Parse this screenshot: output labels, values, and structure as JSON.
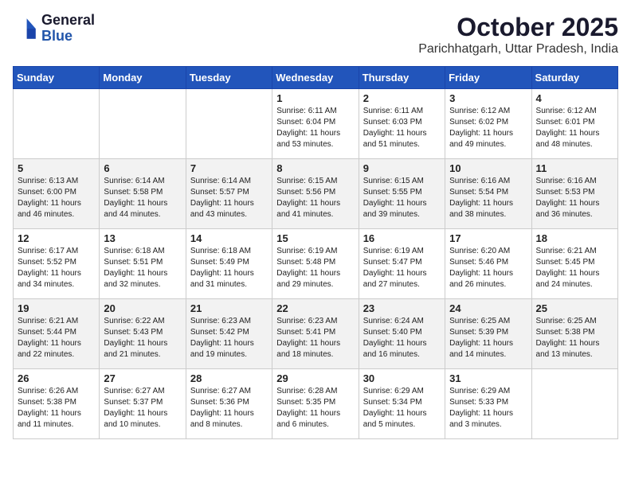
{
  "logo": {
    "line1": "General",
    "line2": "Blue"
  },
  "title": "October 2025",
  "location": "Parichhatgarh, Uttar Pradesh, India",
  "days_of_week": [
    "Sunday",
    "Monday",
    "Tuesday",
    "Wednesday",
    "Thursday",
    "Friday",
    "Saturday"
  ],
  "weeks": [
    [
      {
        "day": "",
        "text": "",
        "shaded": false
      },
      {
        "day": "",
        "text": "",
        "shaded": false
      },
      {
        "day": "",
        "text": "",
        "shaded": false
      },
      {
        "day": "1",
        "text": "Sunrise: 6:11 AM\nSunset: 6:04 PM\nDaylight: 11 hours and 53 minutes.",
        "shaded": false
      },
      {
        "day": "2",
        "text": "Sunrise: 6:11 AM\nSunset: 6:03 PM\nDaylight: 11 hours and 51 minutes.",
        "shaded": false
      },
      {
        "day": "3",
        "text": "Sunrise: 6:12 AM\nSunset: 6:02 PM\nDaylight: 11 hours and 49 minutes.",
        "shaded": false
      },
      {
        "day": "4",
        "text": "Sunrise: 6:12 AM\nSunset: 6:01 PM\nDaylight: 11 hours and 48 minutes.",
        "shaded": false
      }
    ],
    [
      {
        "day": "5",
        "text": "Sunrise: 6:13 AM\nSunset: 6:00 PM\nDaylight: 11 hours and 46 minutes.",
        "shaded": true
      },
      {
        "day": "6",
        "text": "Sunrise: 6:14 AM\nSunset: 5:58 PM\nDaylight: 11 hours and 44 minutes.",
        "shaded": true
      },
      {
        "day": "7",
        "text": "Sunrise: 6:14 AM\nSunset: 5:57 PM\nDaylight: 11 hours and 43 minutes.",
        "shaded": true
      },
      {
        "day": "8",
        "text": "Sunrise: 6:15 AM\nSunset: 5:56 PM\nDaylight: 11 hours and 41 minutes.",
        "shaded": true
      },
      {
        "day": "9",
        "text": "Sunrise: 6:15 AM\nSunset: 5:55 PM\nDaylight: 11 hours and 39 minutes.",
        "shaded": true
      },
      {
        "day": "10",
        "text": "Sunrise: 6:16 AM\nSunset: 5:54 PM\nDaylight: 11 hours and 38 minutes.",
        "shaded": true
      },
      {
        "day": "11",
        "text": "Sunrise: 6:16 AM\nSunset: 5:53 PM\nDaylight: 11 hours and 36 minutes.",
        "shaded": true
      }
    ],
    [
      {
        "day": "12",
        "text": "Sunrise: 6:17 AM\nSunset: 5:52 PM\nDaylight: 11 hours and 34 minutes.",
        "shaded": false
      },
      {
        "day": "13",
        "text": "Sunrise: 6:18 AM\nSunset: 5:51 PM\nDaylight: 11 hours and 32 minutes.",
        "shaded": false
      },
      {
        "day": "14",
        "text": "Sunrise: 6:18 AM\nSunset: 5:49 PM\nDaylight: 11 hours and 31 minutes.",
        "shaded": false
      },
      {
        "day": "15",
        "text": "Sunrise: 6:19 AM\nSunset: 5:48 PM\nDaylight: 11 hours and 29 minutes.",
        "shaded": false
      },
      {
        "day": "16",
        "text": "Sunrise: 6:19 AM\nSunset: 5:47 PM\nDaylight: 11 hours and 27 minutes.",
        "shaded": false
      },
      {
        "day": "17",
        "text": "Sunrise: 6:20 AM\nSunset: 5:46 PM\nDaylight: 11 hours and 26 minutes.",
        "shaded": false
      },
      {
        "day": "18",
        "text": "Sunrise: 6:21 AM\nSunset: 5:45 PM\nDaylight: 11 hours and 24 minutes.",
        "shaded": false
      }
    ],
    [
      {
        "day": "19",
        "text": "Sunrise: 6:21 AM\nSunset: 5:44 PM\nDaylight: 11 hours and 22 minutes.",
        "shaded": true
      },
      {
        "day": "20",
        "text": "Sunrise: 6:22 AM\nSunset: 5:43 PM\nDaylight: 11 hours and 21 minutes.",
        "shaded": true
      },
      {
        "day": "21",
        "text": "Sunrise: 6:23 AM\nSunset: 5:42 PM\nDaylight: 11 hours and 19 minutes.",
        "shaded": true
      },
      {
        "day": "22",
        "text": "Sunrise: 6:23 AM\nSunset: 5:41 PM\nDaylight: 11 hours and 18 minutes.",
        "shaded": true
      },
      {
        "day": "23",
        "text": "Sunrise: 6:24 AM\nSunset: 5:40 PM\nDaylight: 11 hours and 16 minutes.",
        "shaded": true
      },
      {
        "day": "24",
        "text": "Sunrise: 6:25 AM\nSunset: 5:39 PM\nDaylight: 11 hours and 14 minutes.",
        "shaded": true
      },
      {
        "day": "25",
        "text": "Sunrise: 6:25 AM\nSunset: 5:38 PM\nDaylight: 11 hours and 13 minutes.",
        "shaded": true
      }
    ],
    [
      {
        "day": "26",
        "text": "Sunrise: 6:26 AM\nSunset: 5:38 PM\nDaylight: 11 hours and 11 minutes.",
        "shaded": false
      },
      {
        "day": "27",
        "text": "Sunrise: 6:27 AM\nSunset: 5:37 PM\nDaylight: 11 hours and 10 minutes.",
        "shaded": false
      },
      {
        "day": "28",
        "text": "Sunrise: 6:27 AM\nSunset: 5:36 PM\nDaylight: 11 hours and 8 minutes.",
        "shaded": false
      },
      {
        "day": "29",
        "text": "Sunrise: 6:28 AM\nSunset: 5:35 PM\nDaylight: 11 hours and 6 minutes.",
        "shaded": false
      },
      {
        "day": "30",
        "text": "Sunrise: 6:29 AM\nSunset: 5:34 PM\nDaylight: 11 hours and 5 minutes.",
        "shaded": false
      },
      {
        "day": "31",
        "text": "Sunrise: 6:29 AM\nSunset: 5:33 PM\nDaylight: 11 hours and 3 minutes.",
        "shaded": false
      },
      {
        "day": "",
        "text": "",
        "shaded": false
      }
    ]
  ]
}
